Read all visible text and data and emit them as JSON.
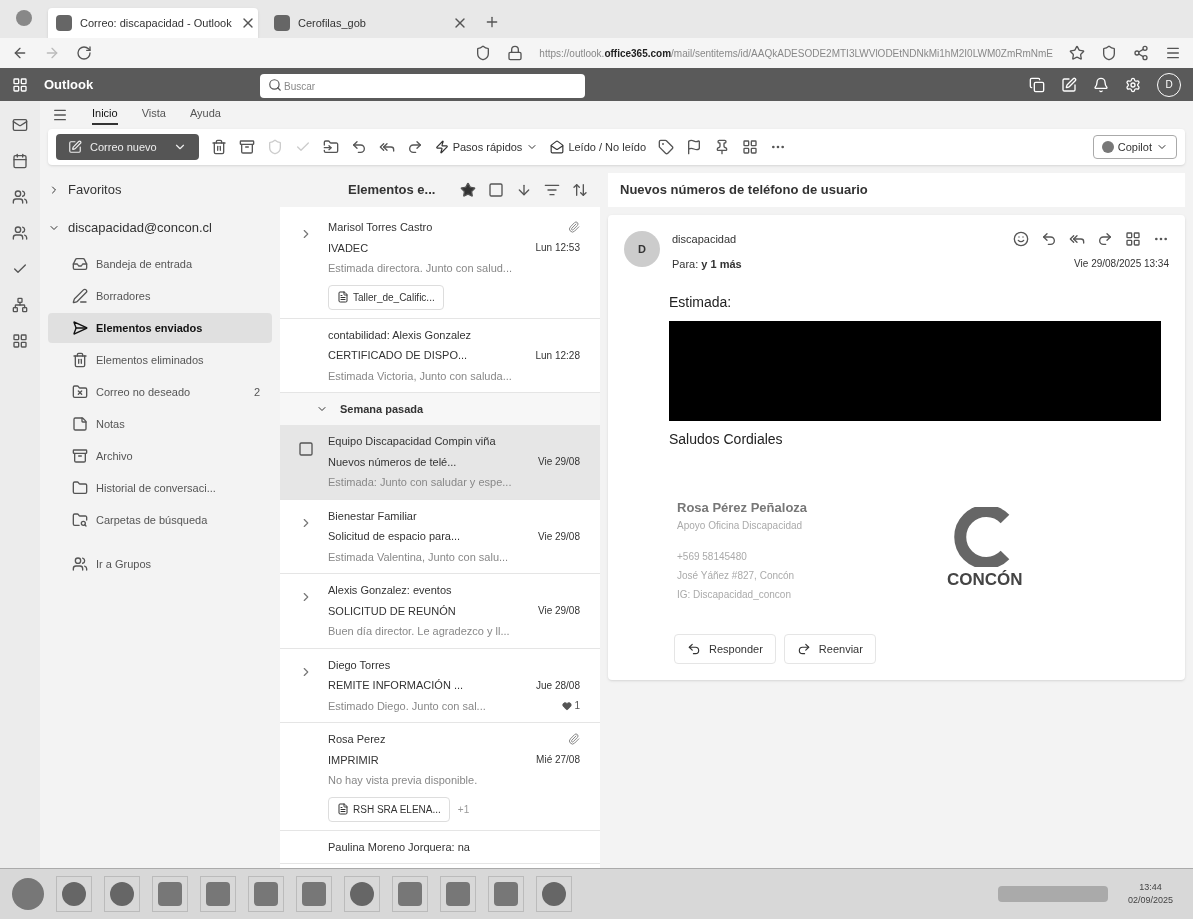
{
  "browser": {
    "tabs": [
      {
        "title": "Correo: discapacidad - Outlook",
        "selected": true
      },
      {
        "title": "Cerofilas_gob",
        "selected": false
      }
    ],
    "url_prefix": "https://outlook.",
    "url_domain": "office365.com",
    "url_path": "/mail/sentitems/id/AAQkADESODE2MTI3LWVlODEtNDNkMi1hM2I0LWM0ZmRmNmE"
  },
  "header": {
    "app_name": "Outlook",
    "search_placeholder": "Buscar",
    "avatar": "D"
  },
  "ribbon": {
    "tabs": [
      {
        "label": "Inicio",
        "selected": true
      },
      {
        "label": "Vista",
        "selected": false
      },
      {
        "label": "Ayuda",
        "selected": false
      }
    ],
    "new_mail": "Correo nuevo",
    "quick_steps": "Pasos rápidos",
    "read_unread": "Leído / No leído",
    "copilot": "Copilot"
  },
  "folders": {
    "favorites": {
      "label": "Favoritos",
      "expanded": false
    },
    "account": {
      "label": "discapacidad@concon.cl",
      "expanded": true
    },
    "items": [
      {
        "kind": "inbox",
        "label": "Bandeja de entrada",
        "selected": false
      },
      {
        "kind": "drafts",
        "label": "Borradores",
        "selected": false
      },
      {
        "kind": "sent",
        "label": "Elementos enviados",
        "selected": true
      },
      {
        "kind": "deleted",
        "label": "Elementos eliminados",
        "selected": false
      },
      {
        "kind": "junk",
        "label": "Correo no deseado",
        "count": "2",
        "selected": false
      },
      {
        "kind": "notes",
        "label": "Notas",
        "selected": false
      },
      {
        "kind": "archive",
        "label": "Archivo",
        "selected": false
      },
      {
        "kind": "history",
        "label": "Historial de conversaci...",
        "selected": false
      },
      {
        "kind": "search",
        "label": "Carpetas de búsqueda",
        "selected": false
      },
      {
        "kind": "groups",
        "label": "Ir a Grupos",
        "selected": false
      }
    ]
  },
  "message_list": {
    "title": "Elementos e...",
    "items": [
      {
        "kind": "message",
        "thread": true,
        "sender": "Marisol Torres Castro",
        "subject": "IVADEC",
        "date": "Lun 12:53",
        "preview": "Estimada directora. Junto con salud...",
        "attachment": "Taller_de_Calific...",
        "selected": false
      },
      {
        "kind": "message",
        "thread": false,
        "sender": "contabilidad: Alexis Gonzalez",
        "subject": "CERTIFICADO DE DISPO...",
        "date": "Lun 12:28",
        "preview": "Estimada Victoria, Junto con saluda...",
        "selected": false
      },
      {
        "kind": "group",
        "label": "Semana pasada"
      },
      {
        "kind": "message",
        "thread": false,
        "sender": "Equipo Discapacidad Compin viña",
        "subject": "Nuevos números de telé...",
        "date": "Vie 29/08",
        "preview": "Estimada: Junto con saludar y espe...",
        "selected": true
      },
      {
        "kind": "message",
        "thread": true,
        "sender": "Bienestar Familiar",
        "subject": "Solicitud de espacio para...",
        "date": "Vie 29/08",
        "preview": "Estimada Valentina, Junto con salu...",
        "selected": false
      },
      {
        "kind": "message",
        "thread": true,
        "sender": "Alexis Gonzalez: eventos",
        "subject": "SOLICITUD DE REUNÓN",
        "date": "Vie 29/08",
        "preview": "Buen día director. Le agradezco y ll...",
        "selected": false
      },
      {
        "kind": "message",
        "thread": true,
        "sender": "Diego Torres",
        "subject": "REMITE INFORMACIÓN ...",
        "date": "Jue 28/08",
        "preview": "Estimado Diego. Junto con sal...",
        "reactions": "1",
        "selected": false
      },
      {
        "kind": "message",
        "thread": false,
        "sender": "Rosa Perez",
        "subject": "IMPRIMIR",
        "date": "Mié 27/08",
        "preview": "No hay vista previa disponible.",
        "attachment": "RSH SRA ELENA...",
        "more_attachments": "+1",
        "selected": false
      },
      {
        "kind": "message",
        "thread": false,
        "sender": "Paulina Moreno Jorquera: na",
        "selected": false
      }
    ]
  },
  "reading": {
    "subject": "Nuevos números de teléfono de usuario",
    "avatar": "D",
    "sender": "discapacidad",
    "to_label": "Para:",
    "to_value": "y 1 más",
    "date": "Vie 29/08/2025 13:34",
    "greeting": "Estimada:",
    "closing": "Saludos Cordiales",
    "signature": {
      "name": "Rosa Pérez Peñaloza",
      "role": "Apoyo Oficina Discapacidad",
      "phone": "+569 58145480",
      "address": "José Yáñez #827, Concón",
      "instagram": "IG: Discapacidad_concon",
      "logo": "CONCÓN"
    },
    "actions": [
      "Responder",
      "Reenviar"
    ]
  },
  "taskbar": {
    "time": "13:44",
    "date": "02/09/2025"
  }
}
